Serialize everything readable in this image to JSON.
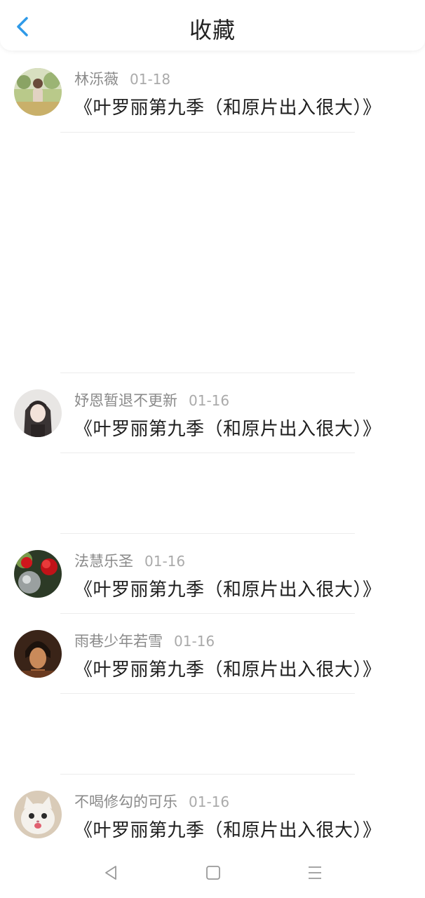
{
  "header": {
    "title": "收藏"
  },
  "favorites": [
    {
      "username": "林泺薇",
      "date": "01-18",
      "title": "《叶罗丽第九季（和原片出入很大）》"
    },
    {
      "username": "妤恩暂退不更新",
      "date": "01-16",
      "title": "《叶罗丽第九季（和原片出入很大）》"
    },
    {
      "username": "法慧乐圣",
      "date": "01-16",
      "title": "《叶罗丽第九季（和原片出入很大）》"
    },
    {
      "username": "雨巷少年若雪",
      "date": "01-16",
      "title": "《叶罗丽第九季（和原片出入很大）》"
    },
    {
      "username": "不喝修勾的可乐",
      "date": "01-16",
      "title": "《叶罗丽第九季（和原片出入很大）》"
    }
  ],
  "icons": {
    "back": "chevron-left-icon",
    "nav_back": "triangle-back-icon",
    "nav_home": "square-home-icon",
    "nav_menu": "menu-lines-icon"
  },
  "colors": {
    "accent": "#2f9ae8",
    "title_text": "#1e1e1e",
    "meta_text": "#8a8a8a",
    "nav_icon": "#9a9a9a"
  }
}
